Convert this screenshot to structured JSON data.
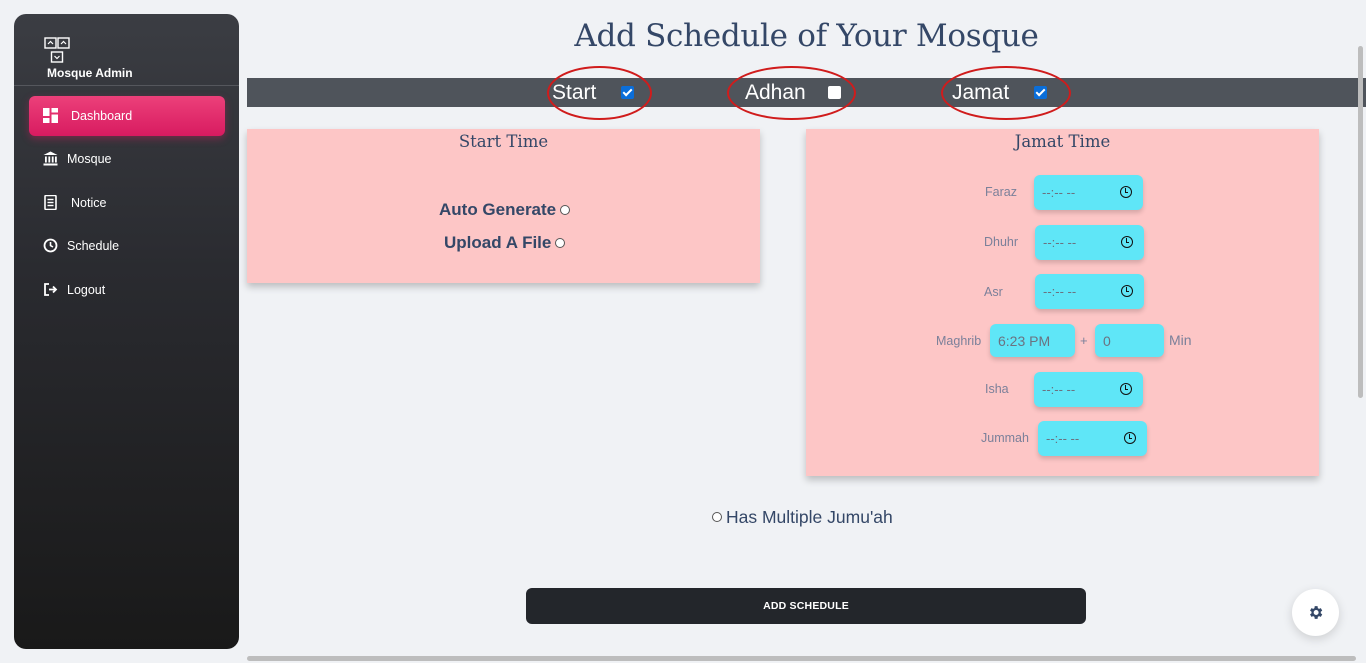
{
  "sidebar": {
    "brand": "Mosque Admin",
    "brand_icon": "sitemap-icon",
    "items": [
      {
        "label": "Dashboard",
        "icon": "dashboard-icon",
        "active": true
      },
      {
        "label": "Mosque",
        "icon": "bank-icon"
      },
      {
        "label": "Notice",
        "icon": "receipt-icon"
      },
      {
        "label": "Schedule",
        "icon": "clock-icon"
      },
      {
        "label": "Logout",
        "icon": "logout-icon"
      }
    ]
  },
  "page_title": "Add Schedule of Your Mosque",
  "toggles": [
    {
      "label": "Start",
      "checked": true
    },
    {
      "label": "Adhan",
      "checked": false
    },
    {
      "label": "Jamat",
      "checked": true
    }
  ],
  "start_card": {
    "title": "Start Time",
    "options": [
      "Auto Generate",
      "Upload A File"
    ]
  },
  "jamat_card": {
    "title": "Jamat Time",
    "placeholder": "--:-- --",
    "rows": {
      "faraz": "Faraz",
      "dhuhr": "Dhuhr",
      "asr": "Asr",
      "maghrib": "Maghrib",
      "isha": "Isha",
      "jummah": "Jummah"
    },
    "maghrib_time": "6:23 PM",
    "maghrib_offset": "0",
    "plus": "+",
    "min_label": "Min"
  },
  "multiple_jumuah": "Has Multiple Jumu'ah",
  "add_button": "ADD SCHEDULE",
  "colors": {
    "accent": "#e91e63",
    "card_bg": "#fdc6c6",
    "input_bg": "#5fe6f7",
    "highlight_ring": "#d01c1c"
  }
}
